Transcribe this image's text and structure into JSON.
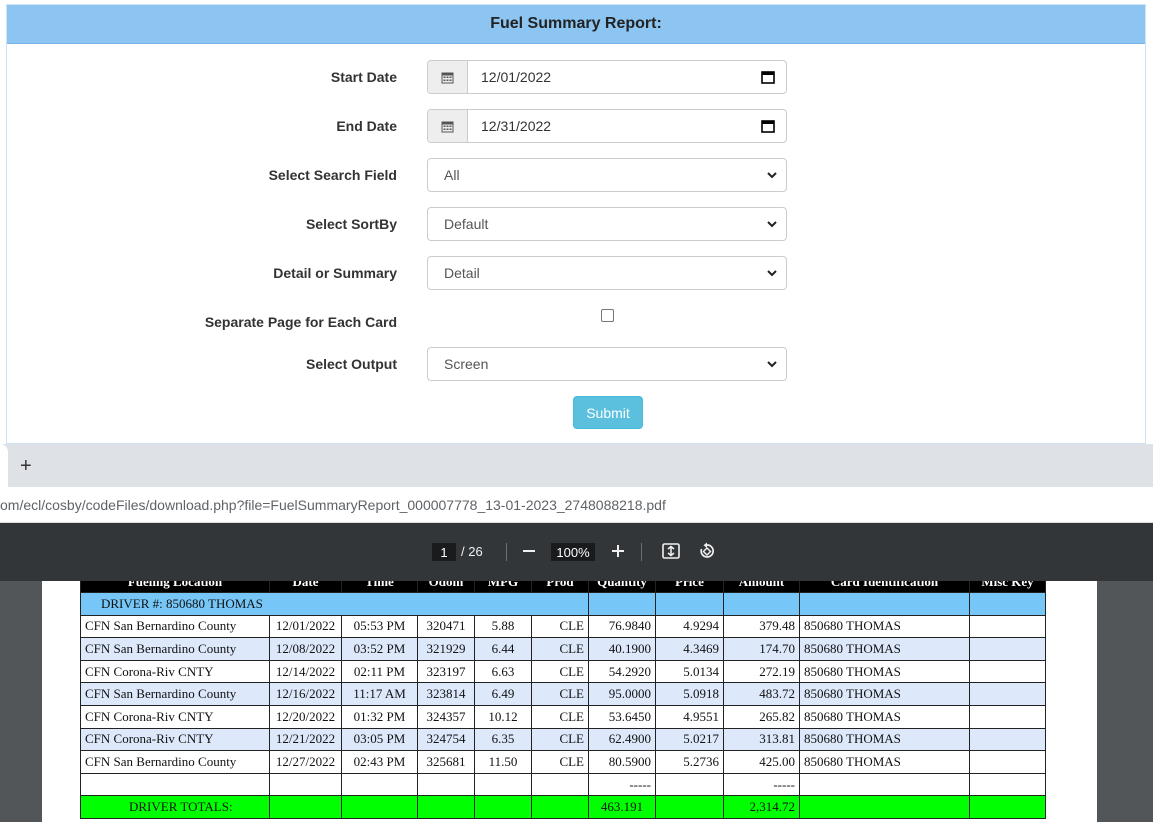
{
  "form": {
    "title": "Fuel Summary Report:",
    "start_date": {
      "label": "Start Date",
      "value": "12/01/2022"
    },
    "end_date": {
      "label": "End Date",
      "value": "12/31/2022"
    },
    "search_field": {
      "label": "Select Search Field",
      "value": "All"
    },
    "sort_by": {
      "label": "Select SortBy",
      "value": "Default"
    },
    "detail_summary": {
      "label": "Detail or Summary",
      "value": "Detail"
    },
    "separate_page": {
      "label": "Separate Page for Each Card",
      "checked": false
    },
    "output": {
      "label": "Select Output",
      "value": "Screen"
    },
    "submit_label": "Submit"
  },
  "browser": {
    "new_tab": "+",
    "url": "om/ecl/cosby/codeFiles/download.php?file=FuelSummaryReport_000007778_13-01-2023_2748088218.pdf"
  },
  "pdf_toolbar": {
    "page": "1",
    "total": "/ 26",
    "zoom": "100%"
  },
  "report": {
    "headers": [
      "Fueling Location",
      "Date",
      "Time",
      "Odom",
      "MPG",
      "Prod",
      "Quantity",
      "Price",
      "Amount",
      "Card Identification",
      "Misc Key"
    ],
    "driver_label": "DRIVER #: 850680    THOMAS",
    "rows": [
      [
        "CFN San Bernardino County",
        "12/01/2022",
        "05:53 PM",
        "320471",
        "5.88",
        "CLE",
        "76.9840",
        "4.9294",
        "379.48",
        "850680   THOMAS",
        ""
      ],
      [
        "CFN San Bernardino County",
        "12/08/2022",
        "03:52 PM",
        "321929",
        "6.44",
        "CLE",
        "40.1900",
        "4.3469",
        "174.70",
        "850680   THOMAS",
        ""
      ],
      [
        "CFN Corona-Riv CNTY",
        "12/14/2022",
        "02:11 PM",
        "323197",
        "6.63",
        "CLE",
        "54.2920",
        "5.0134",
        "272.19",
        "850680   THOMAS",
        ""
      ],
      [
        "CFN San Bernardino County",
        "12/16/2022",
        "11:17 AM",
        "323814",
        "6.49",
        "CLE",
        "95.0000",
        "5.0918",
        "483.72",
        "850680   THOMAS",
        ""
      ],
      [
        "CFN Corona-Riv CNTY",
        "12/20/2022",
        "01:32 PM",
        "324357",
        "10.12",
        "CLE",
        "53.6450",
        "4.9551",
        "265.82",
        "850680   THOMAS",
        ""
      ],
      [
        "CFN Corona-Riv CNTY",
        "12/21/2022",
        "03:05 PM",
        "324754",
        "6.35",
        "CLE",
        "62.4900",
        "5.0217",
        "313.81",
        "850680   THOMAS",
        ""
      ],
      [
        "CFN San Bernardino County",
        "12/27/2022",
        "02:43 PM",
        "325681",
        "11.50",
        "CLE",
        "80.5900",
        "5.2736",
        "425.00",
        "850680   THOMAS",
        ""
      ]
    ],
    "dash_quantity": "-----",
    "dash_amount": "-----",
    "totals_label": "DRIVER TOTALS:",
    "total_quantity": "463.191",
    "total_amount": "2,314.72"
  },
  "colors": {
    "panel_header": "#8dc5f2",
    "submit": "#5bc0de",
    "driver_row": "#76c6f8",
    "alt_row": "#dde9fb",
    "totals_row": "#00ff00",
    "pdf_toolbar": "#323639"
  }
}
